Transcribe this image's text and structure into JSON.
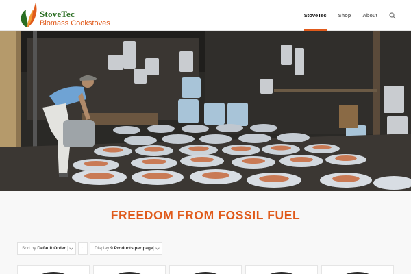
{
  "brand": {
    "name": "StoveTec",
    "tagline": "Biomass Cookstoves",
    "colors": {
      "accent": "#e05a1b",
      "green": "#2a6e22"
    }
  },
  "nav": {
    "items": [
      {
        "label": "StoveTec",
        "active": true
      },
      {
        "label": "Shop",
        "active": false
      },
      {
        "label": "About",
        "active": false
      }
    ],
    "search_icon": "search-icon"
  },
  "hero": {
    "icon": "photo-workshop-stoves"
  },
  "main": {
    "headline": "FREEDOM FROM FOSSIL FUEL",
    "sort": {
      "prefix": "Sort by",
      "value": "Default Order"
    },
    "order_direction_icon": "arrow-up-icon",
    "display": {
      "prefix": "Display",
      "value": "9 Products per page"
    },
    "products_visible": 5
  }
}
